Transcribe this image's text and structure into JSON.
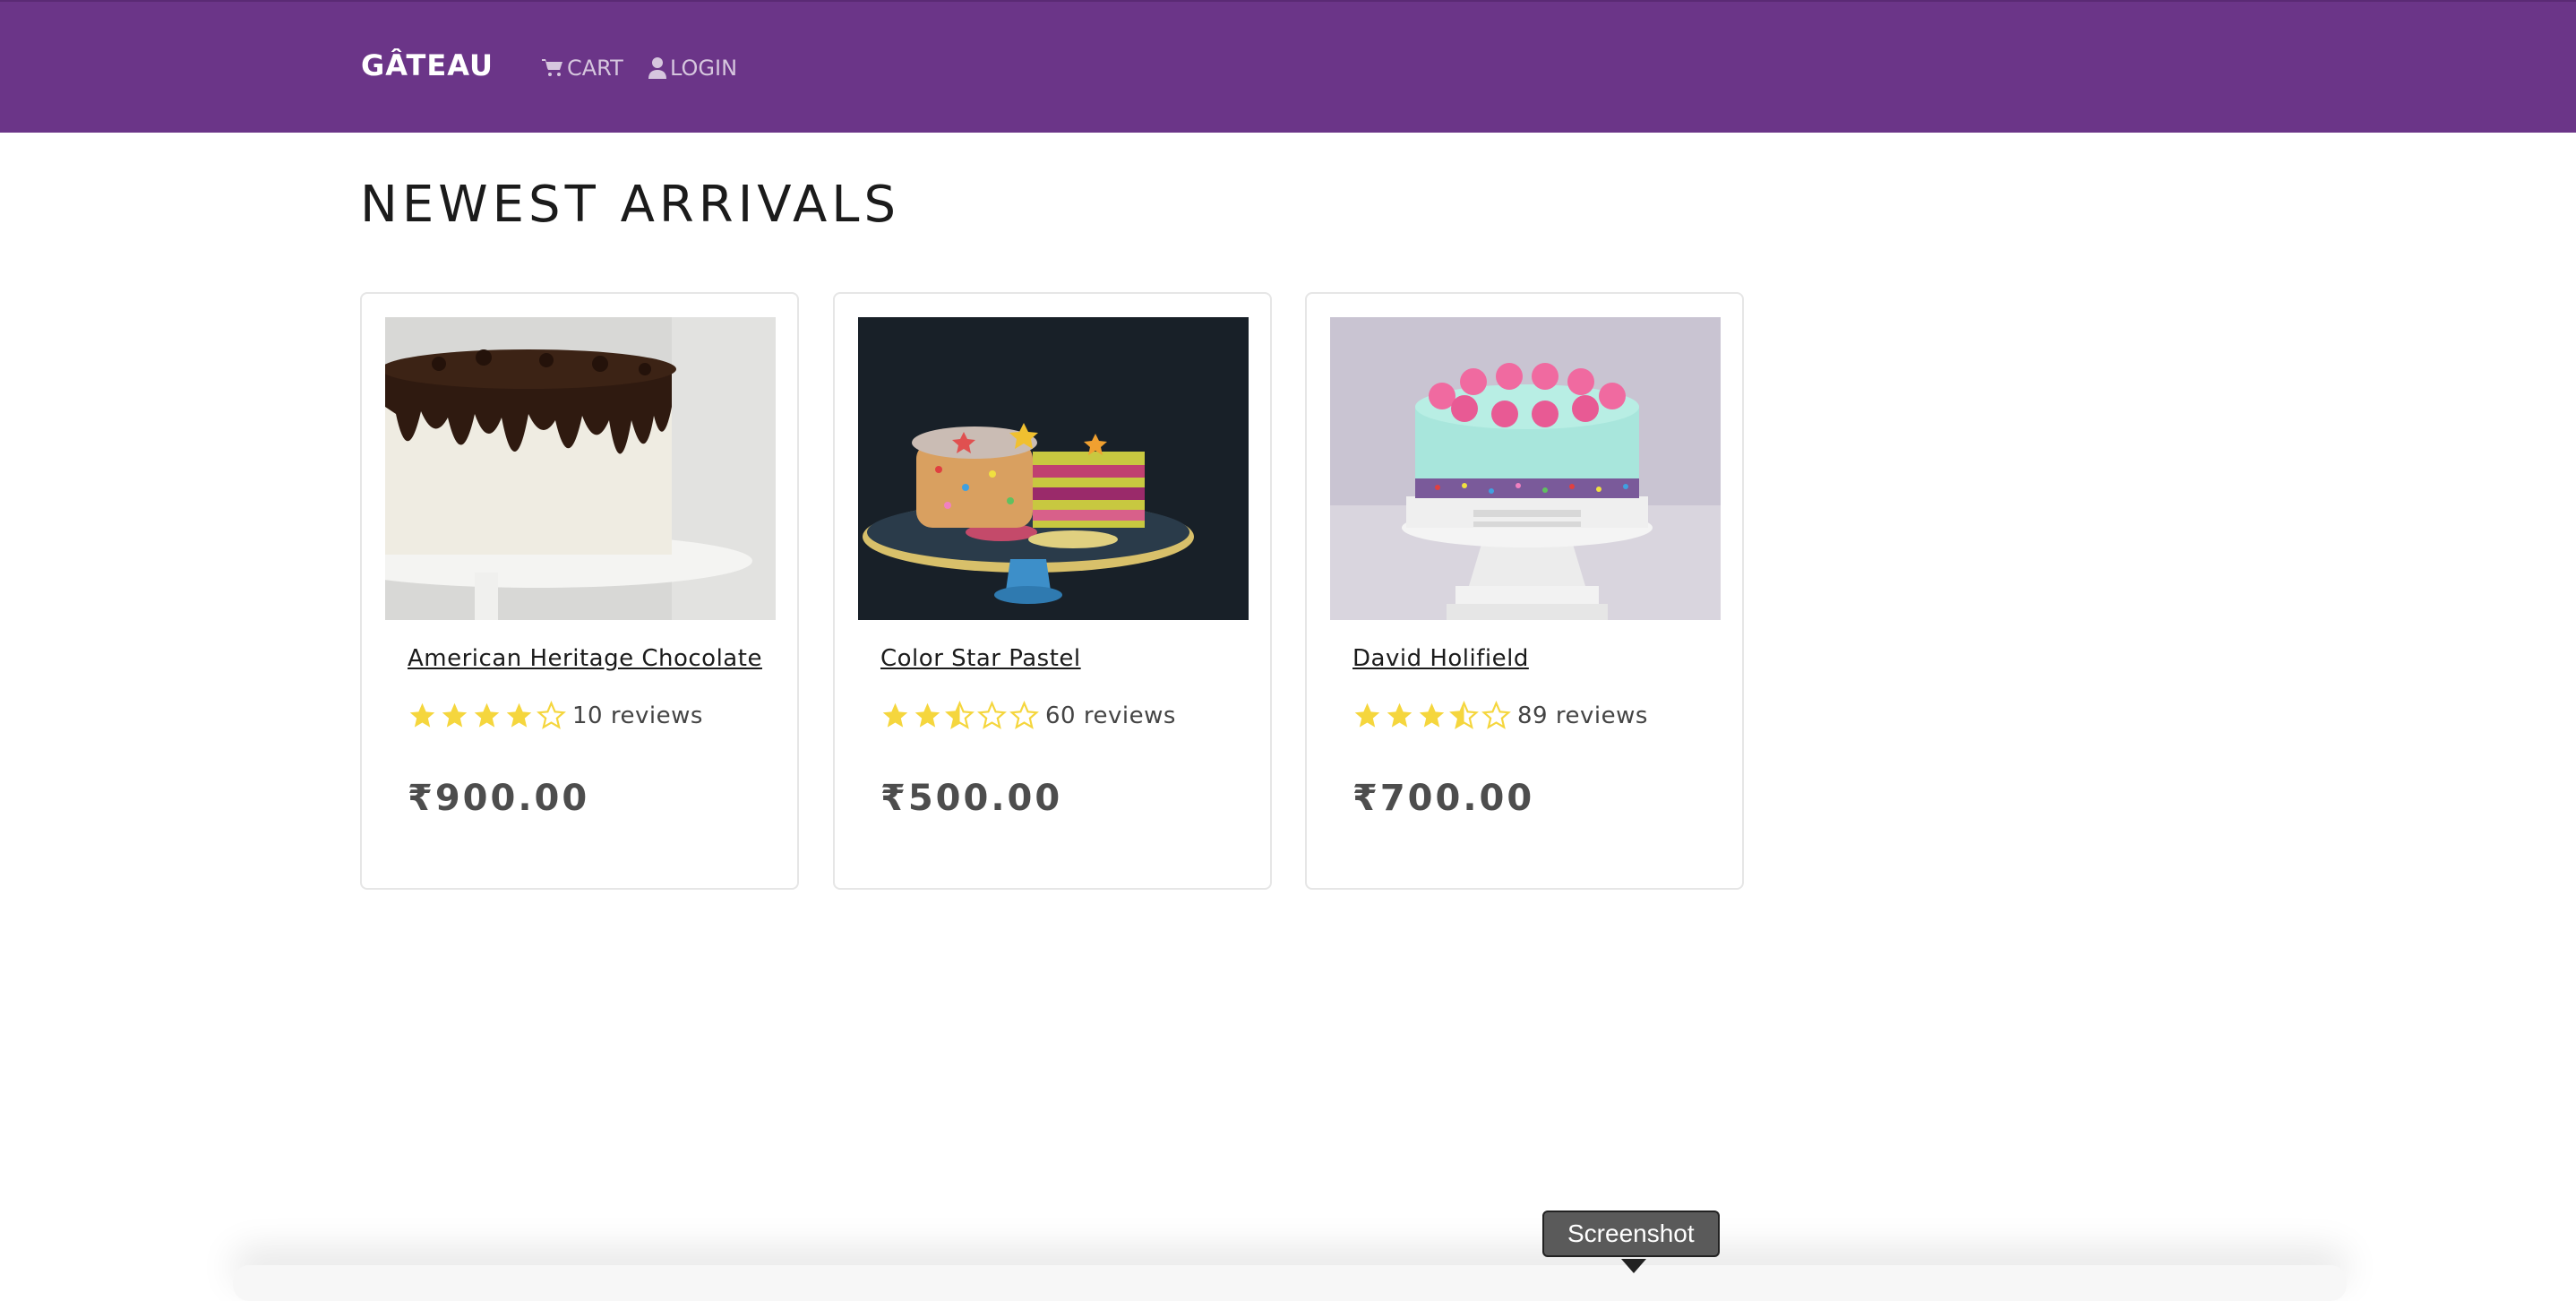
{
  "nav": {
    "brand": "GÂTEAU",
    "cart_label": "CART",
    "login_label": "LOGIN",
    "bg_color": "#6b3588"
  },
  "main": {
    "heading": "NEWEST ARRIVALS",
    "products": [
      {
        "name": "American Heritage Chocolate",
        "rating": 4,
        "reviews_text": "10 reviews",
        "price": "₹900.00",
        "image": "chocolate-drip-cake-image"
      },
      {
        "name": "Color Star Pastel",
        "rating": 2.5,
        "reviews_text": "60 reviews",
        "price": "₹500.00",
        "image": "sprinkle-star-cake-image"
      },
      {
        "name": "David Holifield",
        "rating": 3.5,
        "reviews_text": "89 reviews",
        "price": "₹700.00",
        "image": "mint-pink-cake-image"
      }
    ]
  },
  "tooltip": {
    "label": "Screenshot"
  },
  "colors": {
    "star": "#f5d63d",
    "text": "#1b1b1b",
    "price": "#4d4d4d"
  }
}
